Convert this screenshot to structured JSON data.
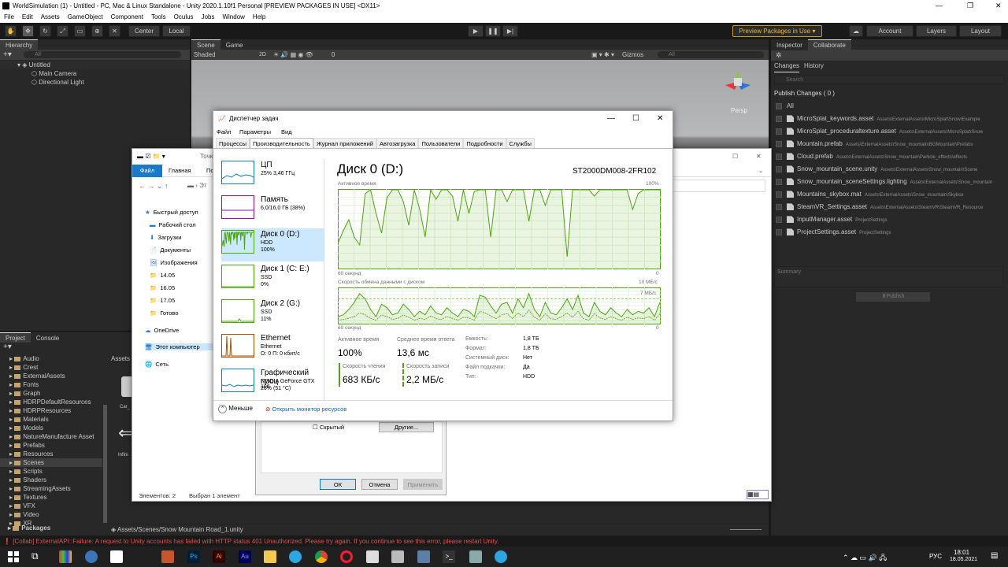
{
  "window": {
    "title": "WorldSimulation (1) - Untitled - PC, Mac & Linux Standalone - Unity 2020.1.10f1 Personal [PREVIEW PACKAGES IN USE] <DX11>",
    "min": "—",
    "max": "❐",
    "close": "✕"
  },
  "menu": [
    "File",
    "Edit",
    "Assets",
    "GameObject",
    "Component",
    "Tools",
    "Oculus",
    "Jobs",
    "Window",
    "Help"
  ],
  "toolbar": {
    "center": "Center",
    "local": "Local",
    "preview": "Preview Packages in Use ▾",
    "account": "Account",
    "layers": "Layers",
    "layout": "Layout"
  },
  "hierarchy": {
    "tab": "Hierarchy",
    "search_placeholder": "All",
    "scene": "Untitled",
    "items": [
      "Main Camera",
      "Directional Light"
    ]
  },
  "scene_view": {
    "tabs": [
      "Scene",
      "Game"
    ],
    "shading": "Shaded",
    "mode2d": "2D",
    "fx_count": "0",
    "gizmos": "Gizmos",
    "search_placeholder": "All",
    "persp": "Persp"
  },
  "inspector": {
    "tabs": [
      "Inspector",
      "Collaborate"
    ],
    "subtabs": [
      "Changes",
      "History"
    ],
    "search_placeholder": "Search",
    "publish_header": "Publish Changes ( 0 )",
    "all_label": "All",
    "changes": [
      {
        "name": "MicroSplat_keywords.asset",
        "path": "Assets\\ExternalAssets\\MicroSplat\\Snow\\Example"
      },
      {
        "name": "MicroSplat_proceduraltexture.asset",
        "path": "Assets\\ExternalAssets\\MicroSplat\\Snow"
      },
      {
        "name": "Mountain.prefab",
        "path": "Assets\\ExternalAssets\\Snow_mountain\\BGMountain\\Prefabs"
      },
      {
        "name": "Cloud.prefab",
        "path": "Assets\\ExternalAssets\\Snow_mountain\\Particle_effects\\effects"
      },
      {
        "name": "Snow_mountain_scene.unity",
        "path": "Assets\\ExternalAssets\\Snow_mountain\\Scene"
      },
      {
        "name": "Snow_mountain_sceneSettings.lighting",
        "path": "Assets\\ExternalAssets\\Snow_mountain"
      },
      {
        "name": "Mountains_skybox.mat",
        "path": "Assets\\ExternalAssets\\Snow_mountain\\Skybox"
      },
      {
        "name": "SteamVR_Settings.asset",
        "path": "Assets\\ExternalAssets\\SteamVR\\SteamVR_Resource"
      },
      {
        "name": "InputManager.asset",
        "path": "ProjectSettings"
      },
      {
        "name": "ProjectSettings.asset",
        "path": "ProjectSettings"
      }
    ],
    "summary_placeholder": "Summary",
    "publish_button": "Publish"
  },
  "project": {
    "tabs": [
      "Project",
      "Console"
    ],
    "folders": [
      "Audio",
      "Crest",
      "ExternalAssets",
      "Fonts",
      "Graph",
      "HDRPDefaultResources",
      "HDRPResources",
      "Materials",
      "Models",
      "NatureManufacture Asset",
      "Prefabs",
      "Resources",
      "Scenes",
      "Scripts",
      "Shaders",
      "StreamingAssets",
      "Textures",
      "VFX",
      "Video",
      "XR"
    ],
    "selected_folder": "Scenes",
    "packages": "Packages",
    "assets_crumb": "Assets",
    "asset_label": "Car_",
    "asset_label2": "Infini",
    "path_bar": "Assets/Scenes/Snow Mountain Road_1.unity"
  },
  "status_error": "[Collab] ExternalAPI::Failure: A request to Unity accounts has failed with HTTP status 401 Unauthorized. Please try again. If you continue to see this error, please restart Unity.",
  "explorer": {
    "ribbon": [
      "Файл",
      "Главная",
      "По"
    ],
    "address": "Эт",
    "title_frag": "Точка (G",
    "nav": [
      "Быстрый доступ",
      "Рабочий стол",
      "Загрузки",
      "Документы",
      "Изображения",
      "14.05",
      "16.05",
      "17.05",
      "Готово",
      "OneDrive",
      "Этот компьютер",
      "Сеть"
    ],
    "status_items": "Элементов: 2",
    "status_selected": "Выбран 1 элемент"
  },
  "props_dialog": {
    "hidden": "Скрытый",
    "other": "Другие...",
    "ok": "ОК",
    "cancel": "Отмена",
    "apply": "Применить"
  },
  "taskmgr": {
    "title": "Диспетчер задач",
    "menu": [
      "Файл",
      "Параметры",
      "Вид"
    ],
    "tabs": [
      "Процессы",
      "Производительность",
      "Журнал приложений",
      "Автозагрузка",
      "Пользователи",
      "Подробности",
      "Службы"
    ],
    "active_tab": 1,
    "sidebar": [
      {
        "t1": "ЦП",
        "t2": "25% 3,46 ГГц",
        "t3": "",
        "color": "#117dbb"
      },
      {
        "t1": "Память",
        "t2": "6,0/16,0 ГБ (38%)",
        "t3": "",
        "color": "#8b12ae"
      },
      {
        "t1": "Диск 0 (D:)",
        "t2": "HDD",
        "t3": "100%",
        "color": "#4da60c"
      },
      {
        "t1": "Диск 1 (C: E:)",
        "t2": "SSD",
        "t3": "0%",
        "color": "#4da60c"
      },
      {
        "t1": "Диск 2 (G:)",
        "t2": "SSD",
        "t3": "11%",
        "color": "#4da60c"
      },
      {
        "t1": "Ethernet",
        "t2": "Ethernet",
        "t3": "О: 0 П: 0 кбит/с",
        "color": "#a74f01"
      },
      {
        "t1": "Графический проц",
        "t2": "NVIDIA GeForce GTX 106",
        "t3": "26% (51 °C)",
        "color": "#117dbb"
      }
    ],
    "disk_title": "Диск 0 (D:)",
    "disk_model": "ST2000DM008-2FR102",
    "chart1": {
      "label": "Активное время",
      "max": "100%",
      "xleft": "60 секунд",
      "xright": "0"
    },
    "chart2": {
      "label": "Скорость обмена данными с диском",
      "max": "10 МБ/с",
      "mark": "7 МБ/с",
      "xleft": "60 секунд",
      "xright": "0"
    },
    "stats": {
      "active_l": "Активное время",
      "active_v": "100%",
      "resp_l": "Среднее время ответа",
      "resp_v": "13,6 мс",
      "read_l": "Скорость чтения",
      "read_v": "683 КБ/с",
      "write_l": "Скорость записи",
      "write_v": "2,2 МБ/с"
    },
    "props": [
      {
        "k": "Емкость:",
        "v": "1,8 ТБ"
      },
      {
        "k": "Формат:",
        "v": "1,8 ТБ"
      },
      {
        "k": "Системный диск:",
        "v": "Нет"
      },
      {
        "k": "Файл подкачки:",
        "v": "Да"
      },
      {
        "k": "Тип:",
        "v": "HDD"
      }
    ],
    "less": "Меньше",
    "monitor": "Открыть монитор ресурсов",
    "activity_series": [
      32,
      48,
      62,
      40,
      30,
      95,
      100,
      70,
      45,
      90,
      100,
      100,
      85,
      55,
      100,
      75,
      40,
      100,
      88,
      100,
      100,
      92,
      60,
      100,
      70,
      98,
      100,
      100,
      40,
      100,
      100,
      85,
      100,
      100,
      100,
      60,
      100,
      100,
      80,
      100,
      100,
      100,
      15,
      100,
      100,
      100,
      100,
      92,
      100,
      100,
      100,
      100,
      100,
      100,
      75,
      95,
      100,
      100,
      100,
      100
    ],
    "transfer_series": [
      20,
      25,
      40,
      60,
      85,
      70,
      40,
      20,
      55,
      45,
      25,
      30,
      55,
      40,
      20,
      35,
      25,
      50,
      30,
      25,
      45,
      30,
      20,
      40,
      35,
      20,
      80,
      75,
      50,
      30,
      55,
      60,
      30,
      70,
      45,
      85,
      40,
      20,
      60,
      30,
      25,
      45,
      70,
      40,
      80,
      30,
      20,
      60,
      35,
      25,
      45,
      30,
      20,
      40,
      25,
      35,
      30,
      45,
      20,
      60
    ],
    "transfer_secondary": [
      10,
      12,
      15,
      20,
      30,
      25,
      15,
      10,
      25,
      20,
      12,
      15,
      25,
      18,
      10,
      15,
      12,
      22,
      14,
      12,
      20,
      15,
      10,
      18,
      16,
      10,
      35,
      30,
      22,
      14,
      25,
      28,
      14,
      30,
      20,
      38,
      18,
      10,
      28,
      14,
      12,
      20,
      30,
      18,
      35,
      14,
      10,
      28,
      16,
      12,
      20,
      14,
      10,
      18,
      12,
      16,
      14,
      20,
      10,
      28
    ]
  },
  "taskbar": {
    "lang": "РУС",
    "time": "18:01",
    "date": "18.05.2021"
  }
}
